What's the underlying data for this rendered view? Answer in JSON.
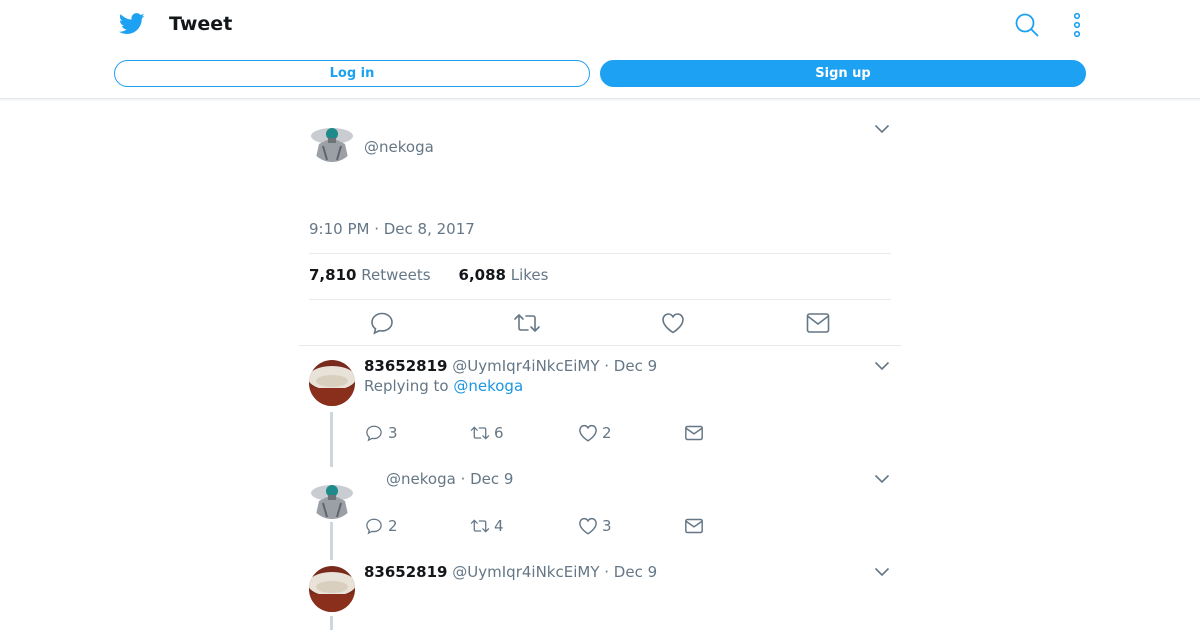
{
  "header": {
    "title": "Tweet",
    "login_label": "Log in",
    "signup_label": "Sign up",
    "icons": [
      "twitter-bird-icon",
      "search-icon",
      "more-vertical-icon"
    ]
  },
  "colors": {
    "accent": "#1da1f2",
    "muted": "#657786",
    "link": "#1b95e0"
  },
  "main_tweet": {
    "handle": "@nekoga",
    "timestamp": "9:10 PM · Dec 8, 2017",
    "retweets_count": "7,810",
    "retweets_label": "Retweets",
    "likes_count": "6,088",
    "likes_label": "Likes"
  },
  "replies": [
    {
      "name": "83652819",
      "handle": "@UymIqr4iNkcEiMY",
      "date": "· Dec 9",
      "replying_prefix": "Replying to",
      "replying_to": "@nekoga",
      "replies": "3",
      "retweets": "6",
      "likes": "2"
    },
    {
      "name": "",
      "handle": "@nekoga",
      "date": "· Dec 9",
      "replies": "2",
      "retweets": "4",
      "likes": "3"
    },
    {
      "name": "83652819",
      "handle": "@UymIqr4iNkcEiMY",
      "date": "· Dec 9"
    }
  ]
}
